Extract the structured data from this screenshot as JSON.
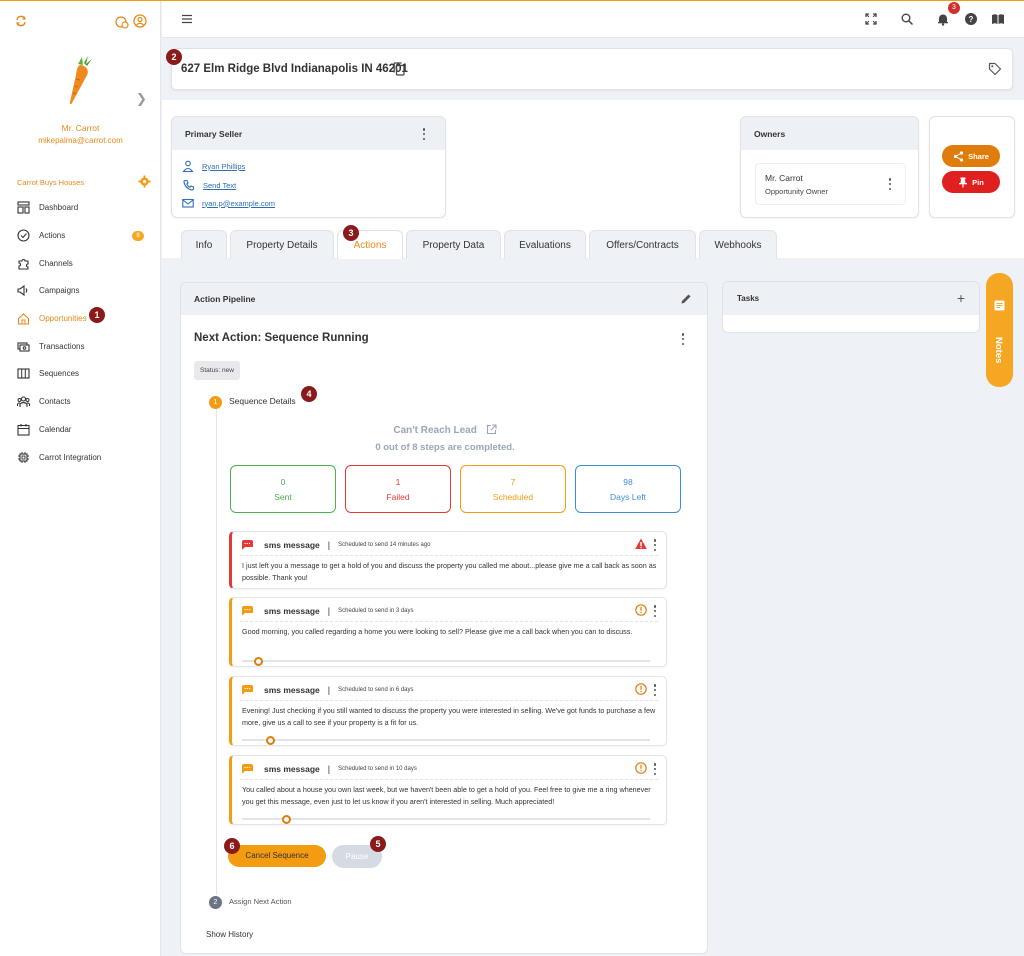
{
  "app": {
    "user": {
      "name": "Mr. Carrot",
      "email": "mikepalma@carrot.com"
    },
    "org": "Carrot Buys Houses"
  },
  "sidebar": {
    "items": [
      {
        "label": "Dashboard",
        "icon": "dashboard-icon"
      },
      {
        "label": "Actions",
        "icon": "check-circle-icon",
        "badge": "8"
      },
      {
        "label": "Channels",
        "icon": "puzzle-icon"
      },
      {
        "label": "Campaigns",
        "icon": "megaphone-icon"
      },
      {
        "label": "Opportunities",
        "icon": "home-icon",
        "active": true
      },
      {
        "label": "Transactions",
        "icon": "money-icon"
      },
      {
        "label": "Sequences",
        "icon": "columns-icon"
      },
      {
        "label": "Contacts",
        "icon": "people-icon"
      },
      {
        "label": "Calendar",
        "icon": "calendar-icon"
      },
      {
        "label": "Carrot Integration",
        "icon": "chip-icon"
      }
    ]
  },
  "markers": {
    "m1": "1",
    "m2": "2",
    "m3": "3",
    "m4": "4",
    "m5": "5",
    "m6": "6"
  },
  "topbar": {
    "notification_count": "3"
  },
  "property": {
    "address": "627 Elm Ridge Blvd Indianapolis IN 46201"
  },
  "primary_seller": {
    "title": "Primary Seller",
    "name": "Ryan Phillips",
    "text_label": "Send Text",
    "email": "ryan.p@example.com"
  },
  "owners": {
    "title": "Owners",
    "owner_name": "Mr. Carrot",
    "owner_role": "Opportunity Owner"
  },
  "actions": {
    "share": "Share",
    "pin": "Pin"
  },
  "tabs": [
    {
      "label": "Info"
    },
    {
      "label": "Property Details"
    },
    {
      "label": "Actions",
      "active": true
    },
    {
      "label": "Property Data"
    },
    {
      "label": "Evaluations"
    },
    {
      "label": "Offers/Contracts"
    },
    {
      "label": "Webhooks"
    }
  ],
  "pipeline": {
    "title": "Action Pipeline",
    "next_action": "Next Action: Sequence Running",
    "status": "Status: new",
    "step1_num": "1",
    "step1_label": "Sequence Details",
    "sequence_name": "Can't Reach Lead",
    "progress_text": "0 out of 8 steps are completed.",
    "stats": [
      {
        "value": "0",
        "label": "Sent",
        "color": "#4caf50"
      },
      {
        "value": "1",
        "label": "Failed",
        "color": "#e53935"
      },
      {
        "value": "7",
        "label": "Scheduled",
        "color": "#f39c12"
      },
      {
        "value": "98",
        "label": "Days Left",
        "color": "#3d8fd6"
      }
    ],
    "messages": [
      {
        "type": "sms message",
        "schedule": "Scheduled to send 14 minutes ago",
        "body": "I just left you a message to get a hold of you and discuss the property you called me about...please give me a call back as soon as possible. Thank you!",
        "state": "failed"
      },
      {
        "type": "sms message",
        "schedule": "Scheduled to send in 3 days",
        "body": "Good morning, you called regarding a home you were looking to sell? Please give me a call back when you can to discuss.",
        "state": "scheduled",
        "progress": 0.04
      },
      {
        "type": "sms message",
        "schedule": "Scheduled to send in 6 days",
        "body": "Evening! Just checking if you still wanted to discuss the property you were interested in selling. We've got funds to purchase a few more, give us a call to see if your property is a fit for us.",
        "state": "scheduled",
        "progress": 0.07
      },
      {
        "type": "sms message",
        "schedule": "Scheduled to send in 10 days",
        "body": "You called about a house you own last week, but we haven't been able to get a hold of you. Feel free to give me a ring whenever you get this message, even just to let us know if you aren't interested in selling. Much appreciated!",
        "state": "scheduled",
        "progress": 0.11
      }
    ],
    "cancel_label": "Cancel Sequence",
    "pause_label": "Pause",
    "step2_num": "2",
    "assign_label": "Assign Next Action",
    "history_label": "Show History"
  },
  "tasks": {
    "title": "Tasks"
  },
  "notes": {
    "label": "Notes"
  },
  "colors": {
    "accent": "#f39c12",
    "brand_orange": "#e8891a",
    "danger": "#e53935"
  }
}
